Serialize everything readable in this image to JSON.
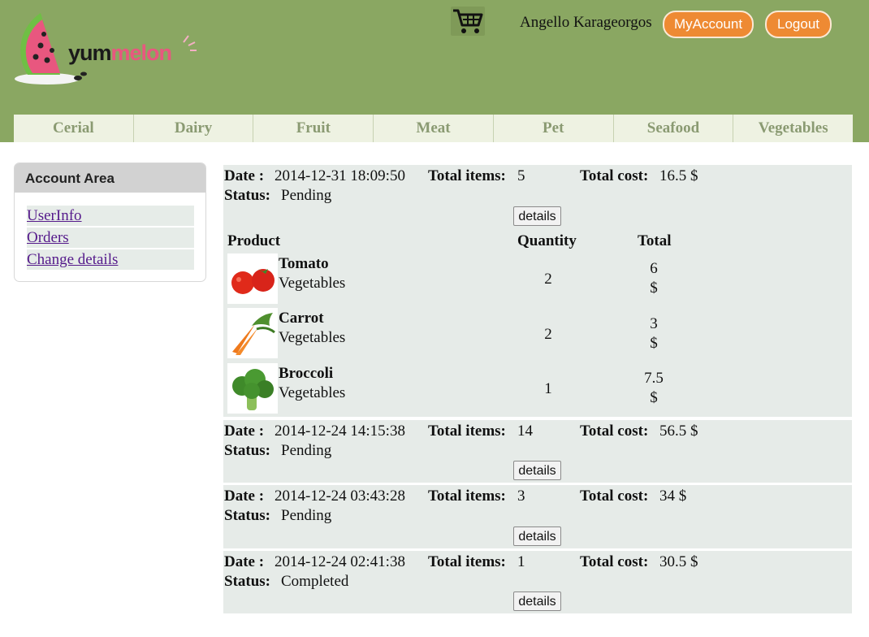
{
  "header": {
    "logo_text_part1": "yum",
    "logo_text_part2": "melon",
    "username": "Angello Karageorgos",
    "myaccount_label": "MyAccount",
    "logout_label": "Logout"
  },
  "categories": [
    "Cerial",
    "Dairy",
    "Fruit",
    "Meat",
    "Pet",
    "Seafood",
    "Vegetables"
  ],
  "sidebar": {
    "title": "Account Area",
    "links": [
      "UserInfo",
      "Orders",
      "Change details"
    ]
  },
  "labels": {
    "date": "Date :",
    "total_items": "Total items:",
    "total_cost": "Total cost:",
    "status": "Status:",
    "details": "details",
    "col_product": "Product",
    "col_quantity": "Quantity",
    "col_total": "Total"
  },
  "orders": [
    {
      "date": "2014-12-31 18:09:50",
      "items": "5",
      "cost": "16.5 $",
      "status": "Pending",
      "products": [
        {
          "name": "Tomato",
          "category": "Vegetables",
          "quantity": "2",
          "total": "6",
          "currency": "$"
        },
        {
          "name": "Carrot",
          "category": "Vegetables",
          "quantity": "2",
          "total": "3",
          "currency": "$"
        },
        {
          "name": "Broccoli",
          "category": "Vegetables",
          "quantity": "1",
          "total": "7.5",
          "currency": "$"
        }
      ]
    },
    {
      "date": "2014-12-24 14:15:38",
      "items": "14",
      "cost": "56.5 $",
      "status": "Pending"
    },
    {
      "date": "2014-12-24 03:43:28",
      "items": "3",
      "cost": "34 $",
      "status": "Pending"
    },
    {
      "date": "2014-12-24 02:41:38",
      "items": "1",
      "cost": "30.5 $",
      "status": "Completed"
    }
  ],
  "colors": {
    "header_bg": "#8aa762",
    "button_orange": "#ee8a33",
    "order_bg": "#e6ebe8",
    "nav_bg": "#eef2e2",
    "nav_text": "#8a9a72",
    "link": "#551a8b"
  },
  "icons": {
    "logo": "watermelon-logo-icon",
    "cart": "shopping-cart-icon"
  }
}
